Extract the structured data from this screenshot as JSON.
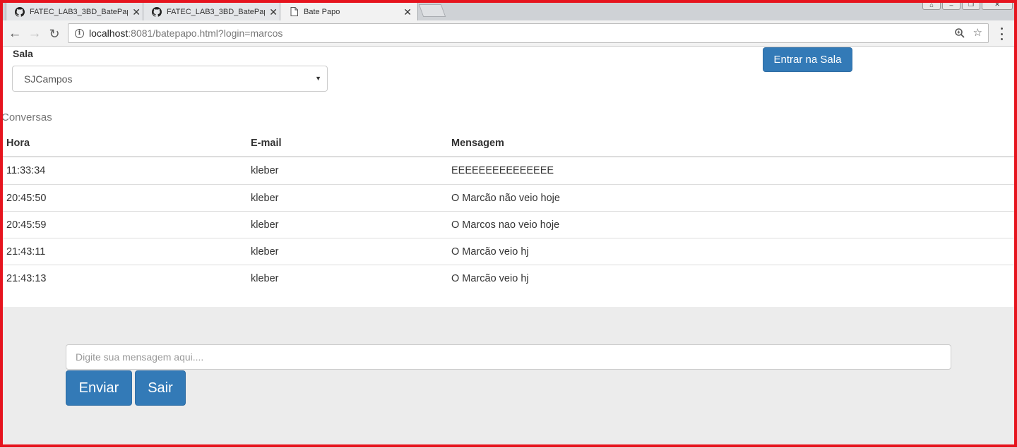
{
  "browser": {
    "tabs": [
      {
        "title": "FATEC_LAB3_3BD_BatePap",
        "icon": "github-icon"
      },
      {
        "title": "FATEC_LAB3_3BD_BatePap",
        "icon": "github-icon"
      },
      {
        "title": "Bate Papo",
        "icon": "page-icon"
      }
    ],
    "url": {
      "host": "localhost",
      "path": ":8081/batepapo.html?login=marcos"
    }
  },
  "room": {
    "label": "Sala",
    "selected": "SJCampos",
    "enter_label": "Entrar na Sala"
  },
  "chat": {
    "section_title": "Conversas",
    "columns": [
      "Hora",
      "E-mail",
      "Mensagem"
    ],
    "rows": [
      {
        "hora": "11:33:34",
        "email": "kleber",
        "mensagem": "EEEEEEEEEEEEEEE"
      },
      {
        "hora": "20:45:50",
        "email": "kleber",
        "mensagem": "O Marcão não veio hoje"
      },
      {
        "hora": "20:45:59",
        "email": "kleber",
        "mensagem": "O Marcos nao veio hoje"
      },
      {
        "hora": "21:43:11",
        "email": "kleber",
        "mensagem": "O Marcão veio hj"
      },
      {
        "hora": "21:43:13",
        "email": "kleber",
        "mensagem": "O Marcão veio hj"
      }
    ]
  },
  "composer": {
    "placeholder": "Digite sua mensagem aqui....",
    "value": "",
    "send_label": "Enviar",
    "exit_label": "Sair"
  },
  "colors": {
    "primary": "#337ab7",
    "composer_bg": "#ececec",
    "frame": "#e6141e"
  }
}
